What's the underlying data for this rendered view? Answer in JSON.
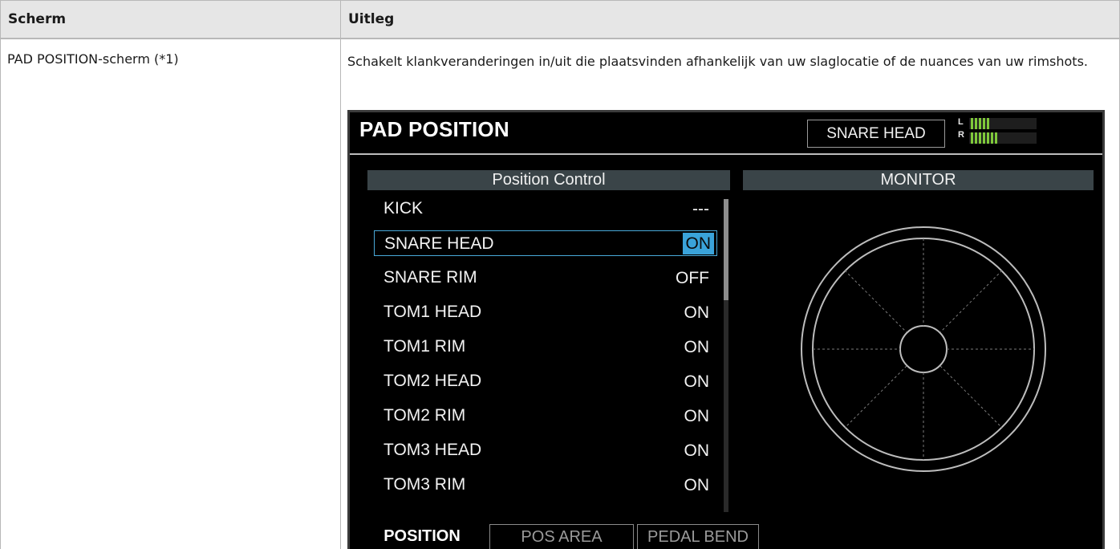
{
  "table": {
    "headers": [
      "Scherm",
      "Uitleg"
    ],
    "row": {
      "scherm": "PAD POSITION-scherm (*1)",
      "uitleg": "Schakelt klankveranderingen in/uit die plaatsvinden afhankelijk van uw slaglocatie of de nuances van uw rimshots."
    }
  },
  "device": {
    "title": "PAD POSITION",
    "instrument": "SNARE HEAD",
    "meter": {
      "left_label": "L",
      "right_label": "R",
      "left_level": 5,
      "right_level": 7
    },
    "section_left": "Position Control",
    "section_right": "MONITOR",
    "items": [
      {
        "label": "KICK",
        "value": "---"
      },
      {
        "label": "SNARE HEAD",
        "value": "ON",
        "selected": true
      },
      {
        "label": "SNARE RIM",
        "value": "OFF"
      },
      {
        "label": "TOM1 HEAD",
        "value": "ON"
      },
      {
        "label": "TOM1 RIM",
        "value": "ON"
      },
      {
        "label": "TOM2 HEAD",
        "value": "ON"
      },
      {
        "label": "TOM2 RIM",
        "value": "ON"
      },
      {
        "label": "TOM3 HEAD",
        "value": "ON"
      },
      {
        "label": "TOM3 RIM",
        "value": "ON"
      }
    ],
    "tabs": [
      {
        "label": "POSITION",
        "active": true
      },
      {
        "label": "POS AREA",
        "active": false
      },
      {
        "label": "PEDAL BEND",
        "active": false
      }
    ],
    "colors": {
      "accent": "#3aa3da",
      "meter": "#7fc93a",
      "section_bg": "#3a4448"
    }
  }
}
